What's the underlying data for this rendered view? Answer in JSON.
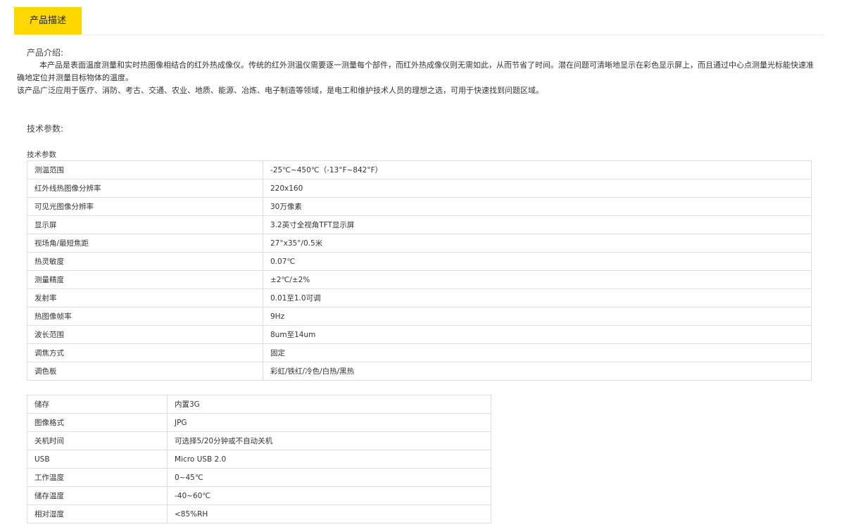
{
  "tabs": [
    {
      "label": "产品描述"
    }
  ],
  "intro": {
    "heading": "产品介绍:",
    "paragraph1": "本产品是表面温度测量和实时热图像相结合的红外热成像仪。传统的红外测温仪需要逐一测量每个部件，而红外热成像仪则无需如此，从而节省了时间。潜在问题可清晰地显示在彩色显示屏上，而且通过中心点测量光标能快速准确地定位并测量目标物体的温度。",
    "paragraph2": "该产品广泛应用于医疗、消防、考古、交通、农业、地质、能源、冶炼、电子制造等领域，是电工和维护技术人员的理想之选，可用于快速找到问题区域。"
  },
  "specs": {
    "heading": "技术参数:",
    "caption": "技术参数",
    "table1": [
      {
        "key": "测温范围",
        "value": "-25℃~450℃（-13°F~842°F）"
      },
      {
        "key": "红外线热图像分辨率",
        "value": "220x160"
      },
      {
        "key": "可见光图像分辨率",
        "value": "30万像素"
      },
      {
        "key": "显示屏",
        "value": "3.2英寸全视角TFT显示屏"
      },
      {
        "key": "视场角/最短焦距",
        "value": "27°x35°/0.5米"
      },
      {
        "key": "热灵敏度",
        "value": "0.07℃"
      },
      {
        "key": "测量精度",
        "value": "±2℃/±2%"
      },
      {
        "key": "发射率",
        "value": "0.01至1.0可调"
      },
      {
        "key": "热图像帧率",
        "value": "9Hz"
      },
      {
        "key": "波长范围",
        "value": "8um至14um"
      },
      {
        "key": "调焦方式",
        "value": "固定"
      },
      {
        "key": "调色板",
        "value": "彩虹/铁红/冷色/白热/黑热"
      }
    ],
    "table2": [
      {
        "key": "储存",
        "value": "内置3G"
      },
      {
        "key": "图像格式",
        "value": "JPG"
      },
      {
        "key": "关机时间",
        "value": "可选择5/20分钟或不自动关机"
      },
      {
        "key": "USB",
        "value": "Micro USB 2.0"
      },
      {
        "key": "工作温度",
        "value": "0~45℃"
      },
      {
        "key": "储存温度",
        "value": "-40~60℃"
      },
      {
        "key": "相对湿度",
        "value": "<85%RH"
      }
    ]
  },
  "colors": {
    "tab_active": "#ffd800",
    "border": "#dddddd",
    "text": "#333333"
  }
}
